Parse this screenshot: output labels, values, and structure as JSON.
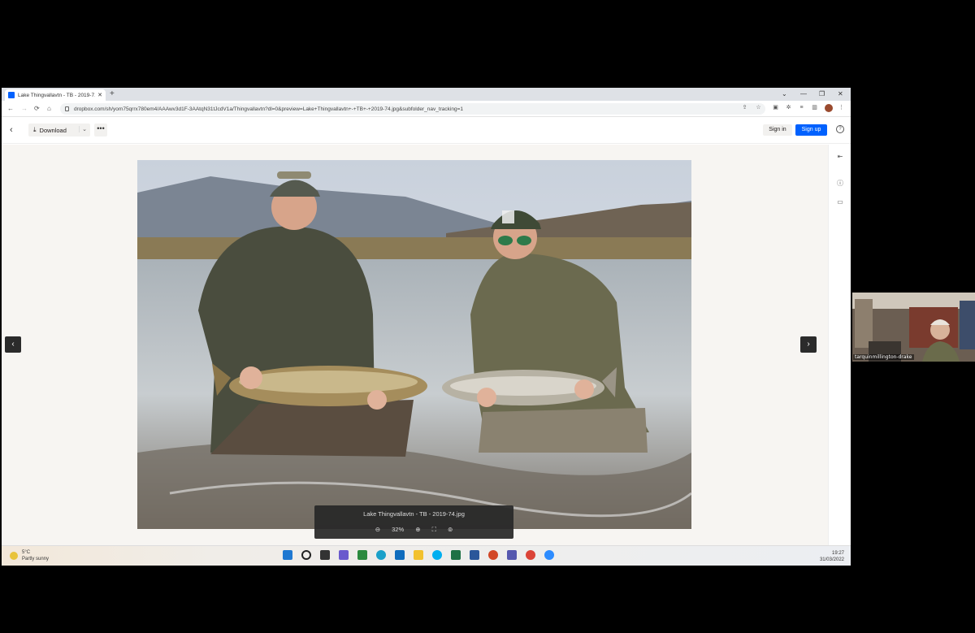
{
  "browser": {
    "tab_title": "Lake Thingvallavtn - TB - 2019-7...",
    "tab_close": "✕",
    "new_tab": "+",
    "url": "dropbox.com/sh/yom75qrrx780em4/AAAwv3d1F-3AAtqN31tJcdV1a/Thingvallavtn?dl=0&preview=Lake+Thingvallavtn+-+TB+-+2019-74.jpg&subfolder_nav_tracking=1",
    "window_controls": [
      "⌄",
      "—",
      "❐",
      "✕"
    ]
  },
  "toolbar": {
    "download_label": "Download",
    "more_label": "•••",
    "sign_in_label": "Sign in",
    "sign_up_label": "Sign up",
    "help_label": "?"
  },
  "viewer": {
    "file_name": "Lake Thingvallavtn - TB - 2019-74.jpg",
    "zoom": "32%",
    "prev_label": "‹",
    "next_label": "›"
  },
  "taskbar": {
    "temperature": "5°C",
    "weather": "Partly sunny",
    "time": "19:27",
    "date": "31/03/2022",
    "apps": [
      "windows-start",
      "search",
      "task-view",
      "chat",
      "store",
      "edge",
      "outlook",
      "explorer",
      "skype",
      "excel",
      "word",
      "powerpoint",
      "teams",
      "chrome",
      "zoom"
    ]
  },
  "webcam": {
    "name": "tarquinmillington-drake"
  },
  "colors": {
    "dropbox_blue": "#0061fe",
    "preview_bg": "#f7f5f2"
  }
}
